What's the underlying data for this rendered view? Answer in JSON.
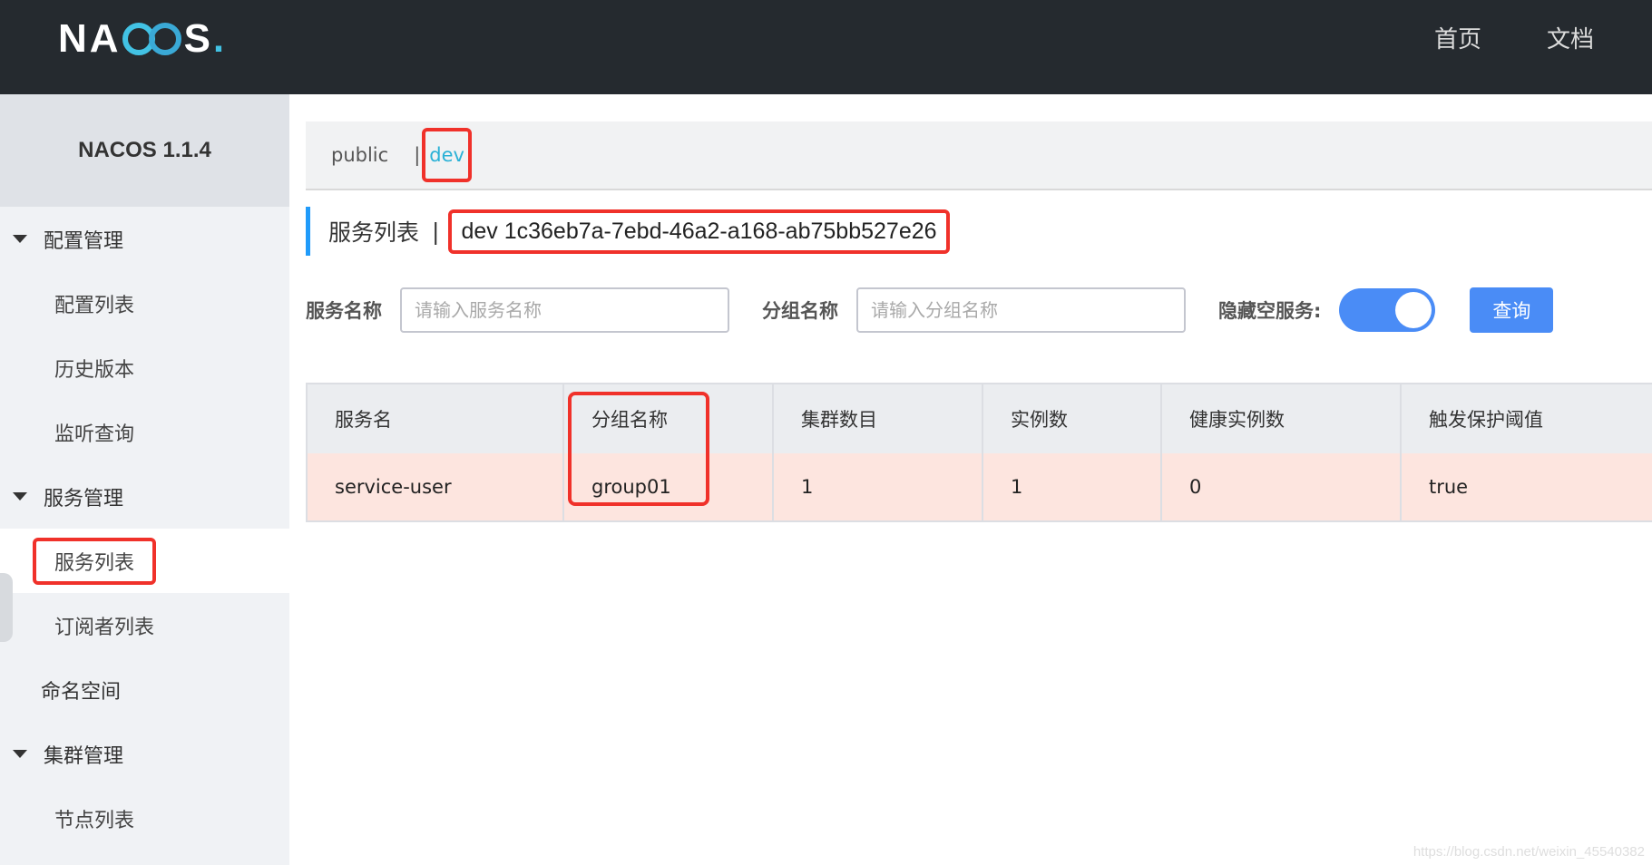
{
  "header": {
    "logo_text": "NACOS.",
    "nav": [
      "首页",
      "文档"
    ]
  },
  "sidebar": {
    "title": "NACOS 1.1.4",
    "groups": [
      {
        "label": "配置管理",
        "items": [
          "配置列表",
          "历史版本",
          "监听查询"
        ]
      },
      {
        "label": "服务管理",
        "items": [
          "服务列表",
          "订阅者列表"
        ]
      },
      {
        "label": "命名空间"
      },
      {
        "label": "集群管理",
        "items": [
          "节点列表"
        ]
      }
    ],
    "active_item": "服务列表"
  },
  "namespaces": {
    "items": [
      "public",
      "dev"
    ],
    "separator": "|",
    "selected": "dev"
  },
  "page": {
    "title": "服务列表",
    "separator": "|",
    "namespace_label": "dev  1c36eb7a-7ebd-46a2-a168-ab75bb527e26"
  },
  "filters": {
    "service_name_label": "服务名称",
    "service_name_placeholder": "请输入服务名称",
    "group_name_label": "分组名称",
    "group_name_placeholder": "请输入分组名称",
    "hide_empty_label": "隐藏空服务:",
    "hide_empty_on": true,
    "query_label": "查询"
  },
  "table": {
    "columns": [
      "服务名",
      "分组名称",
      "集群数目",
      "实例数",
      "健康实例数",
      "触发保护阈值"
    ],
    "rows": [
      [
        "service-user",
        "group01",
        "1",
        "1",
        "0",
        "true"
      ]
    ]
  },
  "watermark": "https://blog.csdn.net/weixin_45540382",
  "colors": {
    "topbar": "#252a2f",
    "accent_blue": "#4a8cf6",
    "namespace_cyan": "#2ab1d6",
    "highlight_red": "#f0312a",
    "row_highlight": "#fde5df"
  }
}
